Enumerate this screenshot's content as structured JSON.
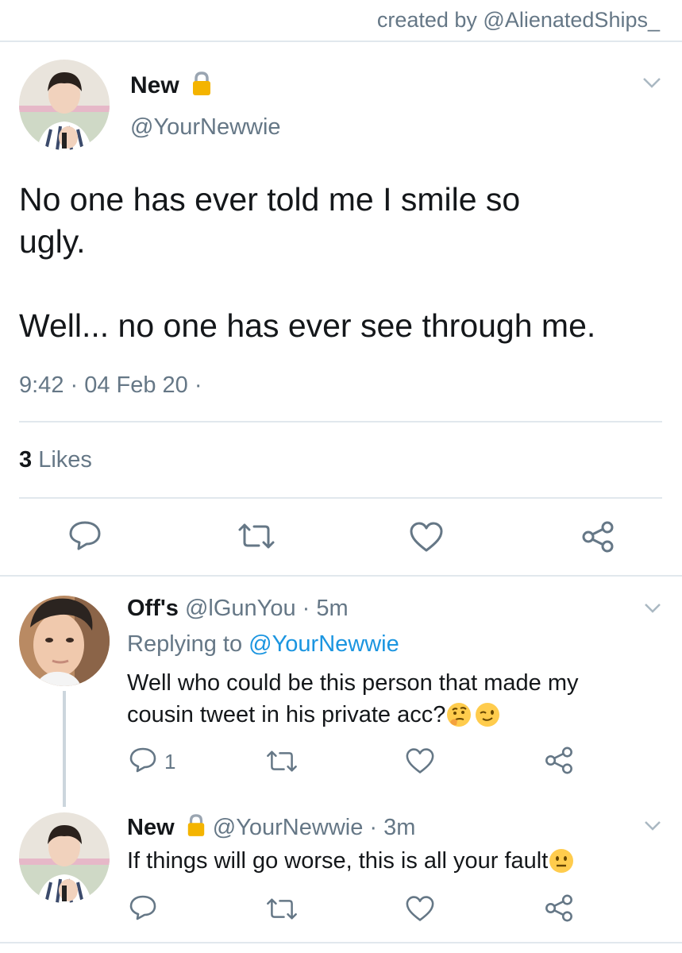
{
  "credit": "created by @AlienatedShips_",
  "main_tweet": {
    "name": "New",
    "handle": "@YourNewwie",
    "text_line1": "No one has ever told me I smile so",
    "text_line2": "ugly.",
    "text_line3": "Well... no one has ever see through me.",
    "timestamp": "9:42 · 04 Feb 20 ·",
    "likes_count": "3",
    "likes_label": "Likes"
  },
  "replies": [
    {
      "name": "Off's",
      "meta": "@lGunYou · 5m",
      "replying_prefix": "Replying to",
      "replying_handle": "@YourNewwie",
      "text_line1": "Well who could be this person that made my",
      "text_line2": "cousin tweet in his private acc?",
      "reply_count": "1"
    },
    {
      "name": "New",
      "meta": "@YourNewwie · 3m",
      "text_line1": "If things will go worse, this is all your fault"
    }
  ],
  "icons": {
    "reply": "speech-bubble",
    "retweet": "retweet-arrows",
    "like": "heart-outline",
    "share": "share-nodes",
    "chevron": "chevron-down",
    "lock": "padlock"
  },
  "colors": {
    "accent": "#1b95e0",
    "muted": "#657786",
    "divider": "#e1e8ed",
    "thread_line": "#ccd6dd",
    "lock": "#f4b400"
  }
}
